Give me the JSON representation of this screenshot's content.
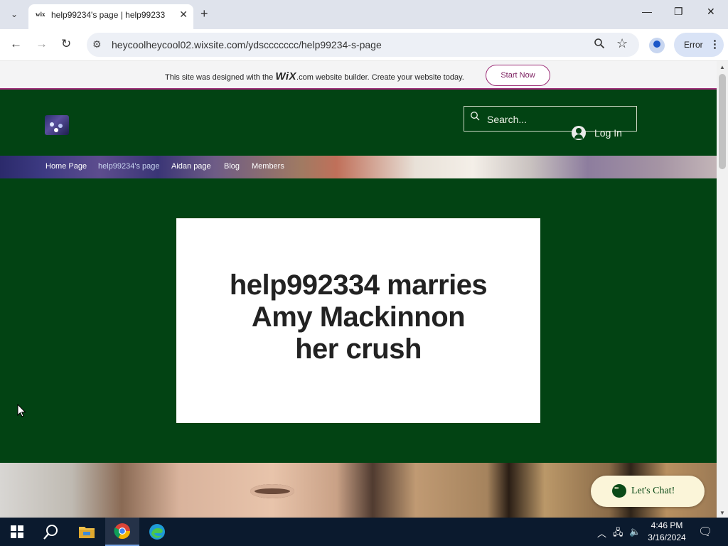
{
  "browser": {
    "tab_title": "help99234's page | help99233",
    "tab_favicon": "wix",
    "url": "heycoolheycool02.wixsite.com/ydsccccccc/help99234-s-page",
    "profile_status": "Error"
  },
  "wix_banner": {
    "text_before": "This site was designed with the ",
    "logo": "WiX",
    "text_after": ".com website builder. Create your website today.",
    "cta": "Start Now"
  },
  "site": {
    "search_placeholder": "Search...",
    "login_label": "Log In",
    "nav": [
      {
        "label": "Home Page"
      },
      {
        "label": "help99234's page"
      },
      {
        "label": "Aidan page"
      },
      {
        "label": "Blog"
      },
      {
        "label": "Members"
      }
    ],
    "headline_lines": [
      "help992334 marries",
      "Amy Mackinnon",
      "her crush"
    ],
    "chat_label": "Let's Chat!"
  },
  "taskbar": {
    "time": "4:46 PM",
    "date": "3/16/2024"
  },
  "colors": {
    "site_background": "#024313",
    "banner_accent": "#9c2b76",
    "chat_background": "#fbf5d9"
  }
}
